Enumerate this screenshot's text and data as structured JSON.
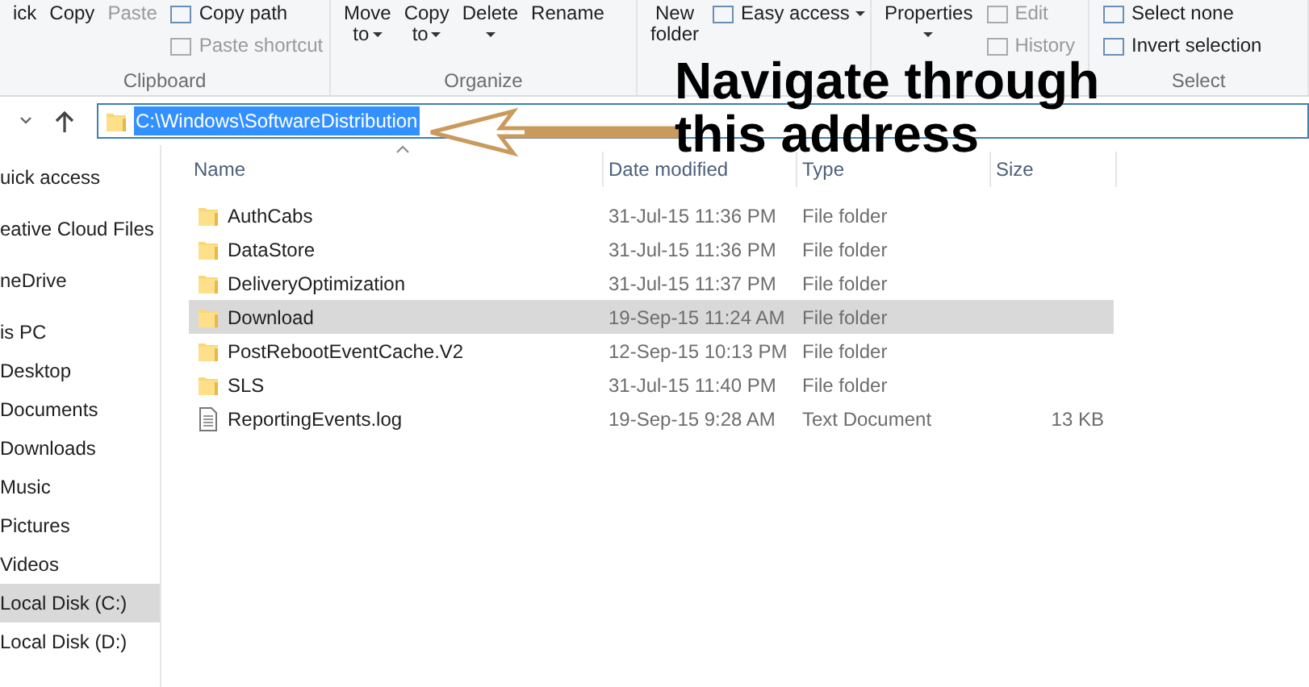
{
  "ribbon": {
    "groups": [
      {
        "label": "Clipboard",
        "large": [
          {
            "label": "ick",
            "disabled": false
          },
          {
            "label": "Copy",
            "disabled": false
          },
          {
            "label": "Paste",
            "disabled": true
          }
        ],
        "small": [
          {
            "label": "Copy path",
            "disabled": false
          },
          {
            "label": "Paste shortcut",
            "disabled": true
          }
        ]
      },
      {
        "label": "Organize",
        "large": [
          {
            "label": "Move",
            "label2": "to",
            "caret": true,
            "disabled": false
          },
          {
            "label": "Copy",
            "label2": "to",
            "caret": true,
            "disabled": false
          },
          {
            "label": "Delete",
            "caret": true,
            "disabled": false
          },
          {
            "label": "Rename",
            "disabled": false
          }
        ]
      },
      {
        "large": [
          {
            "label": "New",
            "label2": "folder",
            "disabled": false
          }
        ],
        "small": [
          {
            "label": "Easy access",
            "caret": true,
            "disabled": false
          }
        ]
      },
      {
        "large": [
          {
            "label": "Properties",
            "caret": true,
            "disabled": false
          }
        ],
        "small": [
          {
            "label": "Edit",
            "disabled": true
          },
          {
            "label": "History",
            "disabled": true
          }
        ]
      },
      {
        "label": "Select",
        "small": [
          {
            "label": "Select none",
            "disabled": false
          },
          {
            "label": "Invert selection",
            "disabled": false
          }
        ]
      }
    ]
  },
  "address": {
    "path": "C:\\Windows\\SoftwareDistribution",
    "selected": true
  },
  "annotation": {
    "text": "Navigate through this address"
  },
  "sidebar": {
    "groups": [
      {
        "items": [
          {
            "label": "uick access",
            "selected": false
          }
        ]
      },
      {
        "items": [
          {
            "label": "eative Cloud Files",
            "selected": false
          }
        ]
      },
      {
        "items": [
          {
            "label": "neDrive",
            "selected": false
          }
        ]
      },
      {
        "items": [
          {
            "label": "is PC",
            "selected": false
          },
          {
            "label": "Desktop",
            "selected": false
          },
          {
            "label": "Documents",
            "selected": false
          },
          {
            "label": "Downloads",
            "selected": false
          },
          {
            "label": "Music",
            "selected": false
          },
          {
            "label": "Pictures",
            "selected": false
          },
          {
            "label": "Videos",
            "selected": false
          },
          {
            "label": "Local Disk (C:)",
            "selected": true
          },
          {
            "label": "Local Disk (D:)",
            "selected": false
          }
        ]
      }
    ]
  },
  "table": {
    "columns": [
      "Name",
      "Date modified",
      "Type",
      "Size"
    ],
    "rows": [
      {
        "kind": "folder",
        "name": "AuthCabs",
        "date": "31-Jul-15 11:36 PM",
        "type": "File folder",
        "size": "",
        "selected": false
      },
      {
        "kind": "folder",
        "name": "DataStore",
        "date": "31-Jul-15 11:36 PM",
        "type": "File folder",
        "size": "",
        "selected": false
      },
      {
        "kind": "folder",
        "name": "DeliveryOptimization",
        "date": "31-Jul-15 11:37 PM",
        "type": "File folder",
        "size": "",
        "selected": false
      },
      {
        "kind": "folder",
        "name": "Download",
        "date": "19-Sep-15 11:24 AM",
        "type": "File folder",
        "size": "",
        "selected": true
      },
      {
        "kind": "folder",
        "name": "PostRebootEventCache.V2",
        "date": "12-Sep-15 10:13 PM",
        "type": "File folder",
        "size": "",
        "selected": false
      },
      {
        "kind": "folder",
        "name": "SLS",
        "date": "31-Jul-15 11:40 PM",
        "type": "File folder",
        "size": "",
        "selected": false
      },
      {
        "kind": "file",
        "name": "ReportingEvents.log",
        "date": "19-Sep-15 9:28 AM",
        "type": "Text Document",
        "size": "13 KB",
        "selected": false
      }
    ]
  }
}
